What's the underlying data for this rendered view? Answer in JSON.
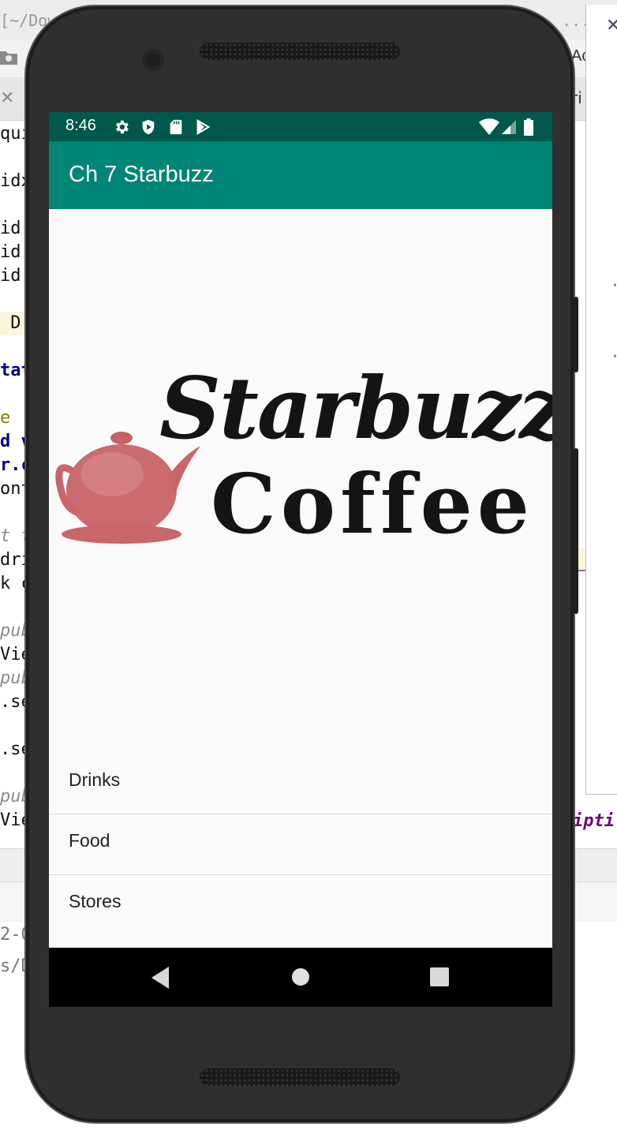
{
  "ide": {
    "title_fragment_left": "[~/Dow",
    "title_fragment_right": "]- ...",
    "toolbar_fragment": "Ac",
    "tab_fragment": "ri",
    "code_fragments": [
      {
        "text": "qui",
        "style": "plain"
      },
      {
        "text": "idx",
        "style": "plain"
      },
      {
        "text": "id",
        "style": "plain"
      },
      {
        "text": "id",
        "style": "plain"
      },
      {
        "text": "id",
        "style": "plain"
      },
      {
        "text": " D",
        "style": "hl"
      },
      {
        "text": "tat",
        "style": "kw"
      },
      {
        "text": "e",
        "style": "an"
      },
      {
        "text": "d v",
        "style": "kw"
      },
      {
        "text": "r.c",
        "style": "kw"
      },
      {
        "text": "ont",
        "style": "plain"
      },
      {
        "text": "t t",
        "style": "cm"
      },
      {
        "text": "dri",
        "style": "plain"
      },
      {
        "text": "k c",
        "style": "plain"
      },
      {
        "text": "pub",
        "style": "cm"
      },
      {
        "text": "Vie",
        "style": "plain"
      },
      {
        "text": "pub",
        "style": "cm"
      },
      {
        "text": ".se",
        "style": "plain"
      },
      {
        "text": ".se",
        "style": "plain"
      },
      {
        "text": "pub",
        "style": "cm"
      },
      {
        "text": "Vie",
        "style": "plain"
      }
    ],
    "console_line_1": "2-0",
    "console_line_2": "s/Do",
    "right_fragment": "ipti"
  },
  "status_bar": {
    "time": "8:46",
    "left_icons": [
      "settings-icon",
      "shield-icon",
      "sd-card-icon",
      "play-store-icon"
    ],
    "right_icons": [
      "wifi-icon",
      "signal-icon",
      "battery-icon"
    ],
    "background": "#00574b"
  },
  "app_bar": {
    "title": "Ch 7 Starbuzz",
    "background": "#008577"
  },
  "logo": {
    "line1": "Starbuzz",
    "line2": "Coffee"
  },
  "list": {
    "items": [
      {
        "label": "Drinks"
      },
      {
        "label": "Food"
      },
      {
        "label": "Stores"
      }
    ]
  },
  "nav_bar": {
    "buttons": [
      "back-icon",
      "home-icon",
      "recents-icon"
    ]
  }
}
